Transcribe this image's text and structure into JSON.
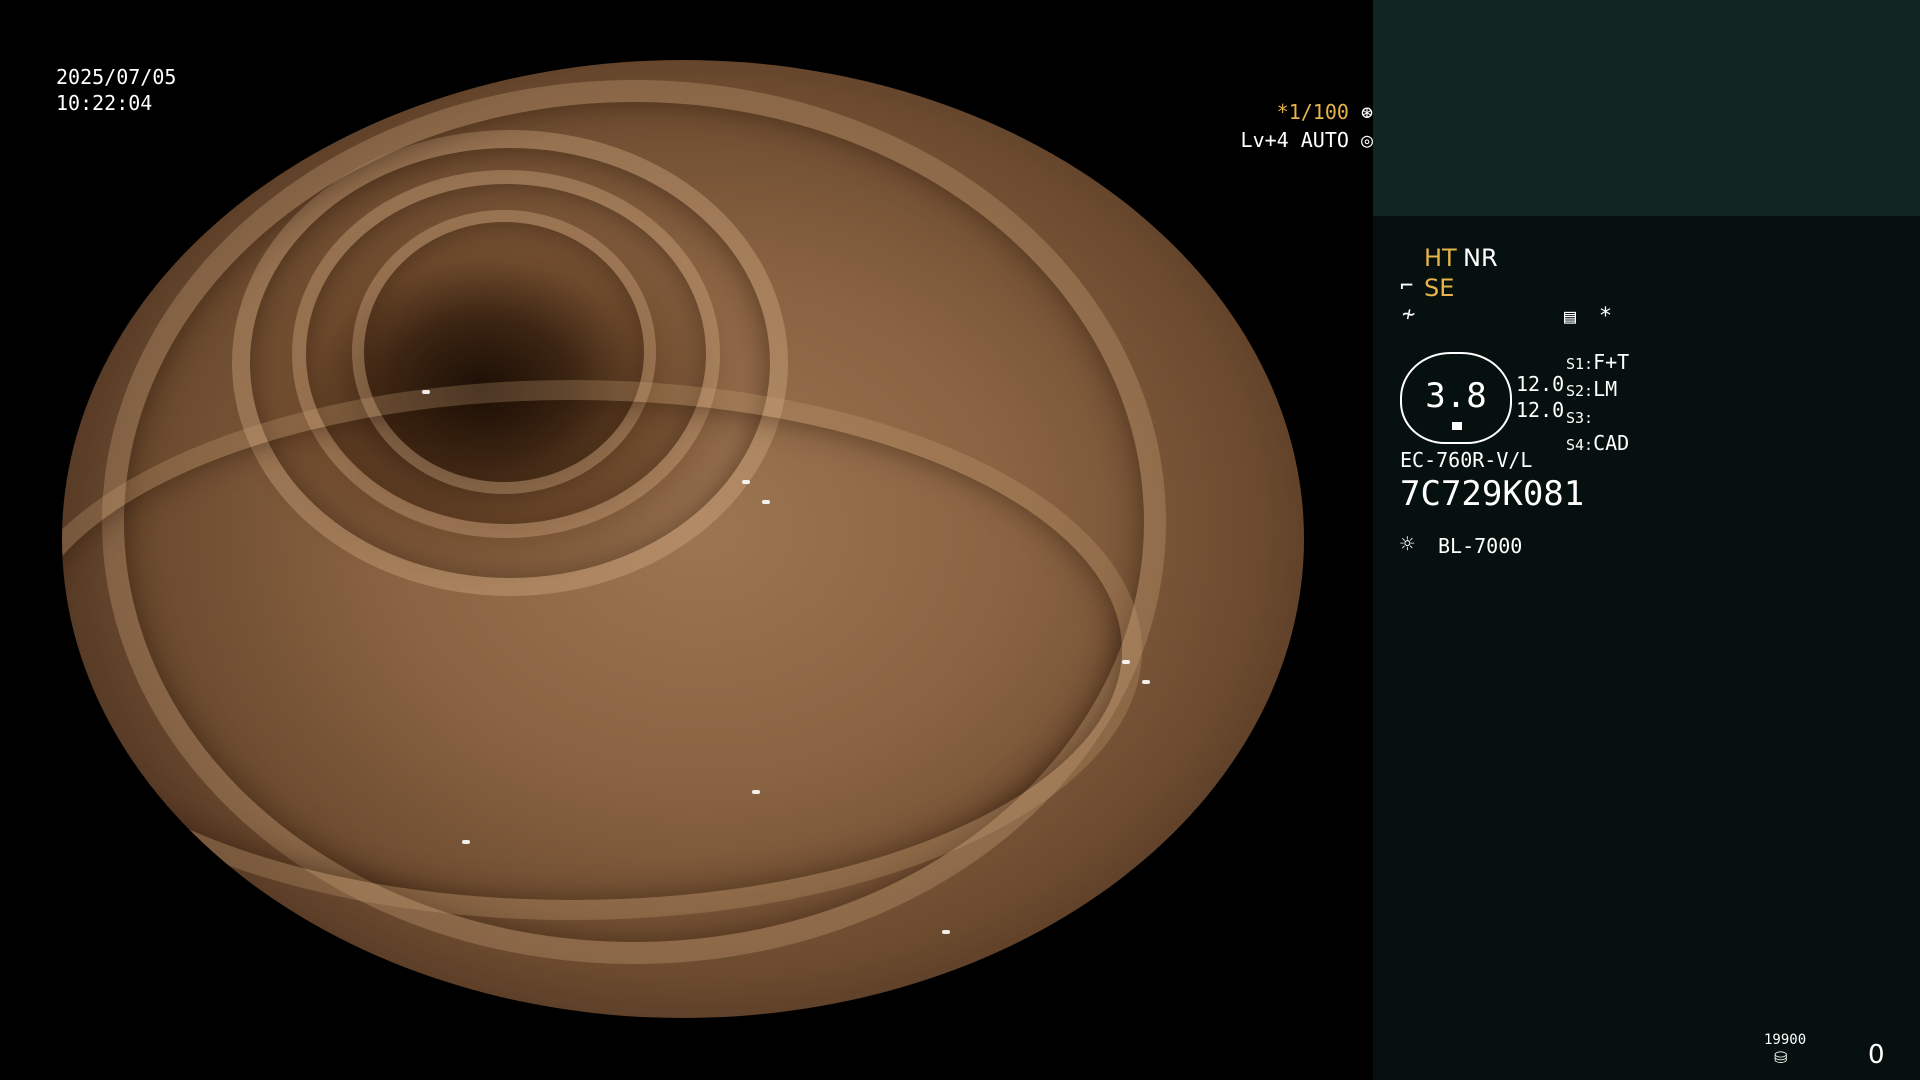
{
  "overlay": {
    "date": "2025/07/05",
    "time": "10:22:04",
    "shutter": "*1/100",
    "shutter_icon": "shutter-icon",
    "iris": "Lv+4 AUTO",
    "iris_icon": "iris-icon"
  },
  "panel": {
    "ht": "HT",
    "nr": "NR",
    "se": "SE",
    "memo_icon": "memo-icon",
    "asterisk": "*",
    "gauge_value": "3.8",
    "gauge_a": "12.0",
    "gauge_b": "12.0",
    "switches": [
      {
        "key": "S1:",
        "value": "F+T"
      },
      {
        "key": "S2:",
        "value": "LM"
      },
      {
        "key": "S3:",
        "value": ""
      },
      {
        "key": "S4:",
        "value": "CAD"
      }
    ],
    "scope_model": "EC-760R-V/L",
    "scope_serial": "7C729K081",
    "light_icon": "light-source-icon",
    "light_source": "BL-7000",
    "counter_small": "19900",
    "counter_icon": "storage-icon",
    "counter": "0"
  },
  "colors": {
    "accent_yellow": "#e6b44a",
    "panel_top": "#0f2623",
    "panel_bg": "#06110f"
  }
}
